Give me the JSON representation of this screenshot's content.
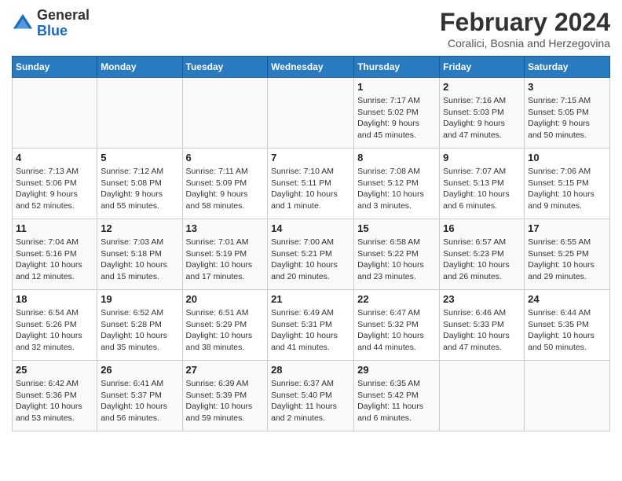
{
  "header": {
    "logo_general": "General",
    "logo_blue": "Blue",
    "month_title": "February 2024",
    "location": "Coralici, Bosnia and Herzegovina"
  },
  "days_of_week": [
    "Sunday",
    "Monday",
    "Tuesday",
    "Wednesday",
    "Thursday",
    "Friday",
    "Saturday"
  ],
  "weeks": [
    [
      {
        "day": "",
        "info": ""
      },
      {
        "day": "",
        "info": ""
      },
      {
        "day": "",
        "info": ""
      },
      {
        "day": "",
        "info": ""
      },
      {
        "day": "1",
        "info": "Sunrise: 7:17 AM\nSunset: 5:02 PM\nDaylight: 9 hours\nand 45 minutes."
      },
      {
        "day": "2",
        "info": "Sunrise: 7:16 AM\nSunset: 5:03 PM\nDaylight: 9 hours\nand 47 minutes."
      },
      {
        "day": "3",
        "info": "Sunrise: 7:15 AM\nSunset: 5:05 PM\nDaylight: 9 hours\nand 50 minutes."
      }
    ],
    [
      {
        "day": "4",
        "info": "Sunrise: 7:13 AM\nSunset: 5:06 PM\nDaylight: 9 hours\nand 52 minutes."
      },
      {
        "day": "5",
        "info": "Sunrise: 7:12 AM\nSunset: 5:08 PM\nDaylight: 9 hours\nand 55 minutes."
      },
      {
        "day": "6",
        "info": "Sunrise: 7:11 AM\nSunset: 5:09 PM\nDaylight: 9 hours\nand 58 minutes."
      },
      {
        "day": "7",
        "info": "Sunrise: 7:10 AM\nSunset: 5:11 PM\nDaylight: 10 hours\nand 1 minute."
      },
      {
        "day": "8",
        "info": "Sunrise: 7:08 AM\nSunset: 5:12 PM\nDaylight: 10 hours\nand 3 minutes."
      },
      {
        "day": "9",
        "info": "Sunrise: 7:07 AM\nSunset: 5:13 PM\nDaylight: 10 hours\nand 6 minutes."
      },
      {
        "day": "10",
        "info": "Sunrise: 7:06 AM\nSunset: 5:15 PM\nDaylight: 10 hours\nand 9 minutes."
      }
    ],
    [
      {
        "day": "11",
        "info": "Sunrise: 7:04 AM\nSunset: 5:16 PM\nDaylight: 10 hours\nand 12 minutes."
      },
      {
        "day": "12",
        "info": "Sunrise: 7:03 AM\nSunset: 5:18 PM\nDaylight: 10 hours\nand 15 minutes."
      },
      {
        "day": "13",
        "info": "Sunrise: 7:01 AM\nSunset: 5:19 PM\nDaylight: 10 hours\nand 17 minutes."
      },
      {
        "day": "14",
        "info": "Sunrise: 7:00 AM\nSunset: 5:21 PM\nDaylight: 10 hours\nand 20 minutes."
      },
      {
        "day": "15",
        "info": "Sunrise: 6:58 AM\nSunset: 5:22 PM\nDaylight: 10 hours\nand 23 minutes."
      },
      {
        "day": "16",
        "info": "Sunrise: 6:57 AM\nSunset: 5:23 PM\nDaylight: 10 hours\nand 26 minutes."
      },
      {
        "day": "17",
        "info": "Sunrise: 6:55 AM\nSunset: 5:25 PM\nDaylight: 10 hours\nand 29 minutes."
      }
    ],
    [
      {
        "day": "18",
        "info": "Sunrise: 6:54 AM\nSunset: 5:26 PM\nDaylight: 10 hours\nand 32 minutes."
      },
      {
        "day": "19",
        "info": "Sunrise: 6:52 AM\nSunset: 5:28 PM\nDaylight: 10 hours\nand 35 minutes."
      },
      {
        "day": "20",
        "info": "Sunrise: 6:51 AM\nSunset: 5:29 PM\nDaylight: 10 hours\nand 38 minutes."
      },
      {
        "day": "21",
        "info": "Sunrise: 6:49 AM\nSunset: 5:31 PM\nDaylight: 10 hours\nand 41 minutes."
      },
      {
        "day": "22",
        "info": "Sunrise: 6:47 AM\nSunset: 5:32 PM\nDaylight: 10 hours\nand 44 minutes."
      },
      {
        "day": "23",
        "info": "Sunrise: 6:46 AM\nSunset: 5:33 PM\nDaylight: 10 hours\nand 47 minutes."
      },
      {
        "day": "24",
        "info": "Sunrise: 6:44 AM\nSunset: 5:35 PM\nDaylight: 10 hours\nand 50 minutes."
      }
    ],
    [
      {
        "day": "25",
        "info": "Sunrise: 6:42 AM\nSunset: 5:36 PM\nDaylight: 10 hours\nand 53 minutes."
      },
      {
        "day": "26",
        "info": "Sunrise: 6:41 AM\nSunset: 5:37 PM\nDaylight: 10 hours\nand 56 minutes."
      },
      {
        "day": "27",
        "info": "Sunrise: 6:39 AM\nSunset: 5:39 PM\nDaylight: 10 hours\nand 59 minutes."
      },
      {
        "day": "28",
        "info": "Sunrise: 6:37 AM\nSunset: 5:40 PM\nDaylight: 11 hours\nand 2 minutes."
      },
      {
        "day": "29",
        "info": "Sunrise: 6:35 AM\nSunset: 5:42 PM\nDaylight: 11 hours\nand 6 minutes."
      },
      {
        "day": "",
        "info": ""
      },
      {
        "day": "",
        "info": ""
      }
    ]
  ]
}
